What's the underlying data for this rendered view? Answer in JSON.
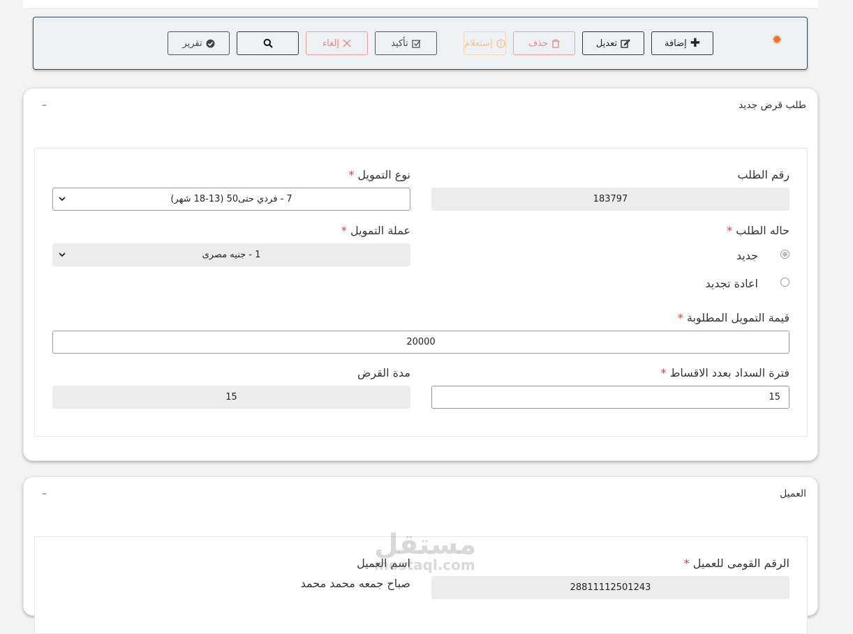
{
  "toolbar": {
    "add_label": "إضافة",
    "edit_label": "تعديل",
    "delete_label": "حذف",
    "inquiry_label": "إستعلام",
    "confirm_label": "تأكيد",
    "cancel_label": "إلغاء",
    "report_label": "تقرير"
  },
  "colors": {
    "accent": "#f36f21",
    "border_dark": "#34495e",
    "required": "#e53935",
    "danger": "#e28a86"
  },
  "loan_card": {
    "title": "طلب قرض جديد",
    "collapse": "–",
    "request_number_label": "رقم الطلب",
    "request_number_value": "183797",
    "funding_type_label": "نوع التمويل",
    "funding_type_value": "7 - فردي حتى50 (13-18 شهر)",
    "request_status_label": "حاله الطلب",
    "status_new": "جديد",
    "status_renew": "اعادة تجديد",
    "currency_label": "عملة التمويل",
    "currency_value": "1 - جنيه مصرى",
    "amount_label": "قيمة التمويل المطلوبة",
    "amount_value": "20000",
    "installments_label": "فترة السداد بعدد الاقساط",
    "installments_value": "15",
    "duration_label": "مدة القرض",
    "duration_value": "15",
    "required_mark": "*"
  },
  "client_card": {
    "title": "العميل",
    "collapse": "–",
    "national_id_label": "الرقم القومى للعميل",
    "national_id_value": "28811112501243",
    "client_name_label": "اسم العميل",
    "client_name_value": "صباح جمعه محمد محمد"
  },
  "watermark": {
    "text1": "مستقل",
    "text2": "mostaql.com"
  }
}
